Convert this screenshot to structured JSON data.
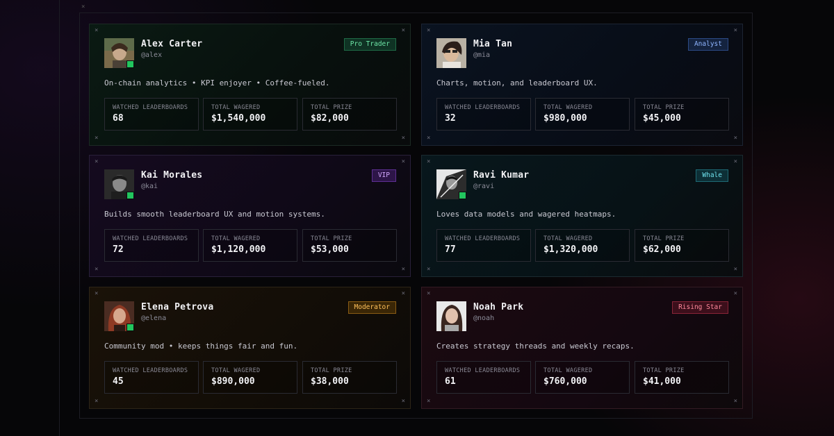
{
  "frame": {
    "corner_glyph": "×"
  },
  "cards": [
    {
      "name": "Alex Carter",
      "handle": "@alex",
      "badge": "Pro Trader",
      "bio": "On-chain analytics • KPI enjoyer • Coffee-fueled.",
      "stats": [
        {
          "label": "WATCHED LEADERBOARDS",
          "value": "68"
        },
        {
          "label": "TOTAL WAGERED",
          "value": "$1,540,000"
        },
        {
          "label": "TOTAL PRIZE",
          "value": "$82,000"
        }
      ],
      "online": true,
      "accent": "#22c55e"
    },
    {
      "name": "Mia Tan",
      "handle": "@mia",
      "badge": "Analyst",
      "bio": "Charts, motion, and leaderboard UX.",
      "stats": [
        {
          "label": "WATCHED LEADERBOARDS",
          "value": "32"
        },
        {
          "label": "TOTAL WAGERED",
          "value": "$980,000"
        },
        {
          "label": "TOTAL PRIZE",
          "value": "$45,000"
        }
      ],
      "online": false,
      "accent": "#3b82f6"
    },
    {
      "name": "Kai Morales",
      "handle": "@kai",
      "badge": "VIP",
      "bio": "Builds smooth leaderboard UX and motion systems.",
      "stats": [
        {
          "label": "WATCHED LEADERBOARDS",
          "value": "72"
        },
        {
          "label": "TOTAL WAGERED",
          "value": "$1,120,000"
        },
        {
          "label": "TOTAL PRIZE",
          "value": "$53,000"
        }
      ],
      "online": true,
      "accent": "#a855f7"
    },
    {
      "name": "Ravi Kumar",
      "handle": "@ravi",
      "badge": "Whale",
      "bio": "Loves data models and wagered heatmaps.",
      "stats": [
        {
          "label": "WATCHED LEADERBOARDS",
          "value": "77"
        },
        {
          "label": "TOTAL WAGERED",
          "value": "$1,320,000"
        },
        {
          "label": "TOTAL PRIZE",
          "value": "$62,000"
        }
      ],
      "online": true,
      "accent": "#06b6d4"
    },
    {
      "name": "Elena Petrova",
      "handle": "@elena",
      "badge": "Moderator",
      "bio": "Community mod • keeps things fair and fun.",
      "stats": [
        {
          "label": "WATCHED LEADERBOARDS",
          "value": "45"
        },
        {
          "label": "TOTAL WAGERED",
          "value": "$890,000"
        },
        {
          "label": "TOTAL PRIZE",
          "value": "$38,000"
        }
      ],
      "online": true,
      "accent": "#f59e0b"
    },
    {
      "name": "Noah Park",
      "handle": "@noah",
      "badge": "Rising Star",
      "bio": "Creates strategy threads and weekly recaps.",
      "stats": [
        {
          "label": "WATCHED LEADERBOARDS",
          "value": "61"
        },
        {
          "label": "TOTAL WAGERED",
          "value": "$760,000"
        },
        {
          "label": "TOTAL PRIZE",
          "value": "$41,000"
        }
      ],
      "online": false,
      "accent": "#ef4444"
    }
  ]
}
